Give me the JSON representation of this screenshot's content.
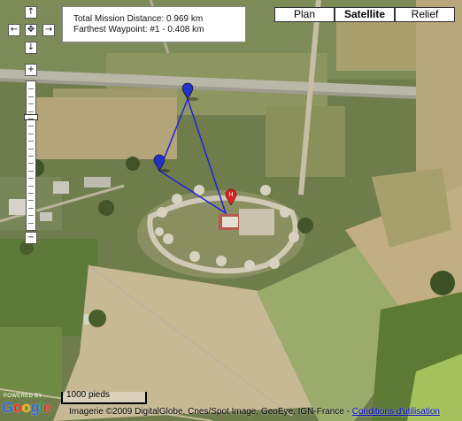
{
  "info": {
    "distance_line": "Total Mission Distance: 0.969 km",
    "farthest_line": "Farthest Waypoint: #1 - 0.408 km"
  },
  "map_types": [
    "Plan",
    "Satellite",
    "Relief"
  ],
  "active_map_type": "Satellite",
  "nav": {
    "pan_up": "↑",
    "pan_left": "←",
    "pan_center": "✥",
    "pan_right": "→",
    "pan_down": "↓",
    "zoom_in": "+",
    "zoom_out": "−"
  },
  "zoom_level_fraction": 0.23,
  "scale": {
    "label": "1000 pieds"
  },
  "footer": {
    "powered_by": "POWERED BY",
    "google_logo": "Google",
    "copyright_text": "Imagerie ©2009 DigitalGlobe, Cnes/Spot Image, GeoEye, IGN-France - ",
    "terms_link": "Conditions d'utilisation"
  },
  "colors": {
    "route_line": "#2222dd",
    "waypoint_marker": "#2233cc",
    "home_marker": "#dd2222"
  }
}
